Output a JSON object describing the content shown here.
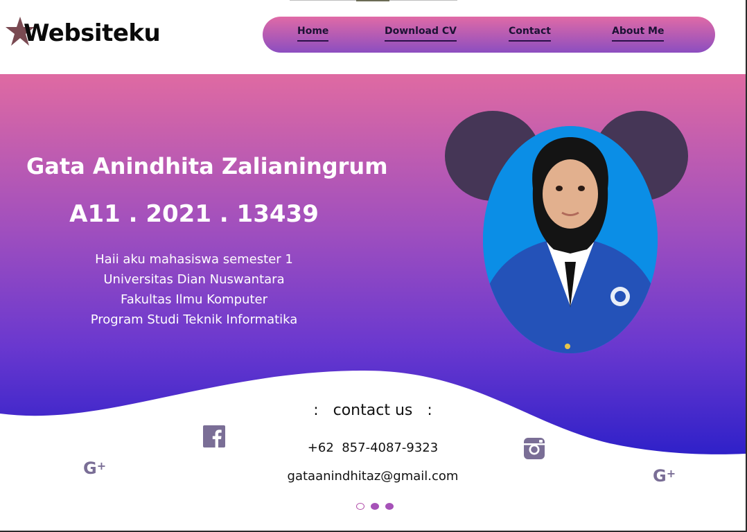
{
  "brand": {
    "logo_text": "Websiteku",
    "accent_pink": "#e06aa6",
    "accent_blue": "#2b1fc8",
    "star_color": "#7a4a52"
  },
  "nav": {
    "items": [
      {
        "label": "Home"
      },
      {
        "label": "Download CV"
      },
      {
        "label": "Contact"
      },
      {
        "label": "About Me"
      }
    ]
  },
  "hero": {
    "name": "Gata Anindhita Zalianingrum",
    "student_id": "A11 . 2021 . 13439",
    "description_lines": [
      "Haii aku mahasiswa semester 1",
      "Universitas Dian Nuswantara",
      "Fakultas Ilmu Komputer",
      "Program Studi Teknik Informatika"
    ],
    "photo_icon": "profile-photo"
  },
  "contact": {
    "title": ":   contact us   :",
    "phone": "+62  857-4087-9323",
    "email": "gataanindhitaz@gmail.com"
  },
  "social": {
    "facebook_icon": "facebook-icon",
    "instagram_icon": "instagram-icon",
    "gplus_icon": "google-plus-icon",
    "gplus_text": "G",
    "gplus_plus": "+"
  },
  "carousel": {
    "active_index": 0,
    "count": 3
  }
}
